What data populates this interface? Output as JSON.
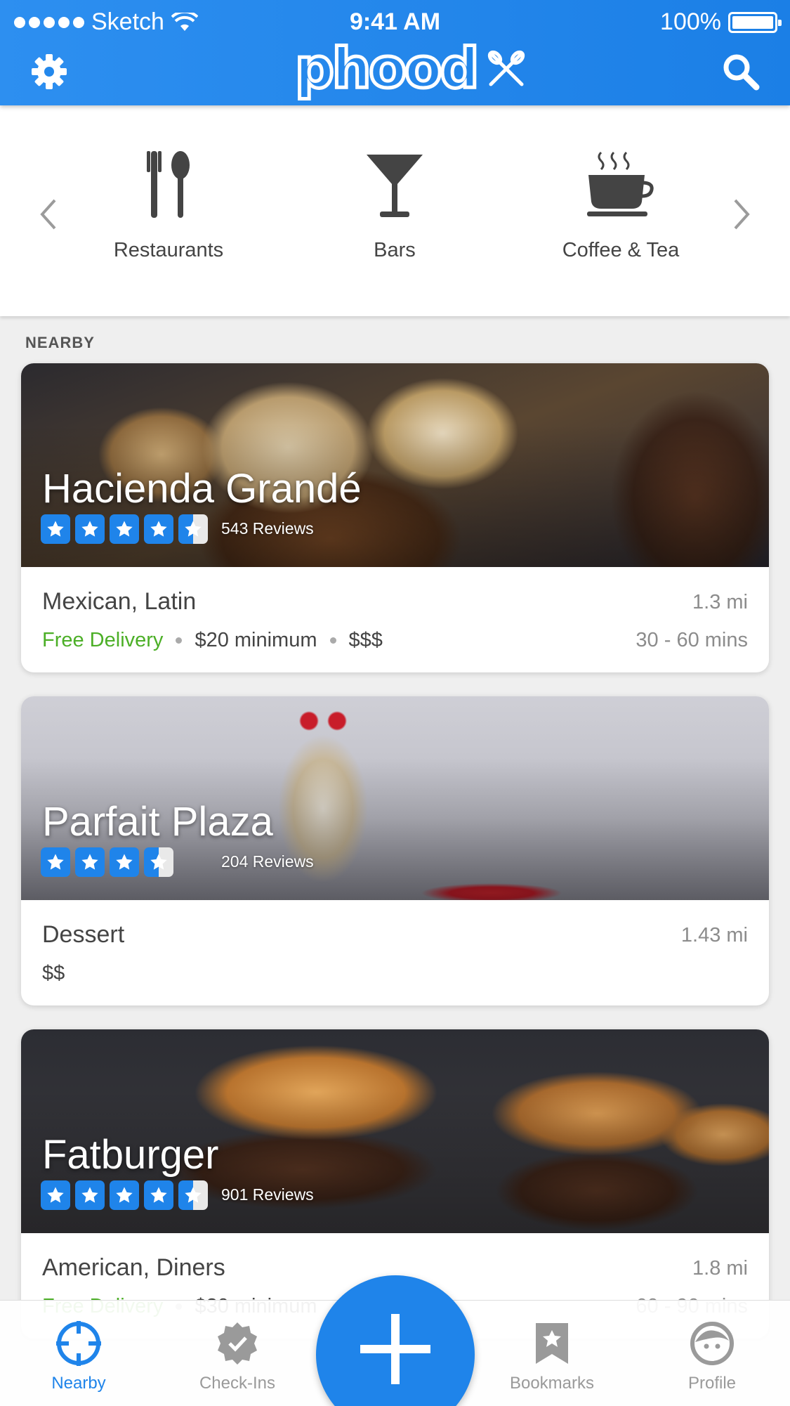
{
  "status_bar": {
    "carrier": "Sketch",
    "time": "9:41 AM",
    "battery": "100%"
  },
  "header": {
    "logo_text": "phood"
  },
  "categories": [
    {
      "label": "Restaurants",
      "icon": "fork-spoon-icon"
    },
    {
      "label": "Bars",
      "icon": "cocktail-glass-icon"
    },
    {
      "label": "Coffee & Tea",
      "icon": "coffee-cup-icon"
    }
  ],
  "section_label": "NEARBY",
  "restaurants": [
    {
      "name": "Hacienda Grandé",
      "rating": 4.5,
      "reviews": "543 Reviews",
      "cuisine": "Mexican, Latin",
      "distance": "1.3 mi",
      "delivery": "Free Delivery",
      "minimum": "$20 minimum",
      "price": "$$$",
      "eta": "30 - 60 mins"
    },
    {
      "name": "Parfait Plaza",
      "rating": 3.5,
      "reviews": "204 Reviews",
      "cuisine": "Dessert",
      "distance": "1.43 mi",
      "price": "$$"
    },
    {
      "name": "Fatburger",
      "rating": 4.5,
      "reviews": "901 Reviews",
      "cuisine": "American, Diners",
      "distance": "1.8 mi",
      "delivery": "Free Delivery",
      "minimum": "$30 minimum",
      "eta": "60 - 90 mins"
    }
  ],
  "tabs": [
    {
      "label": "Nearby",
      "icon": "crosshair-icon",
      "active": true
    },
    {
      "label": "Check-Ins",
      "icon": "checkmark-badge-icon",
      "active": false
    },
    {
      "label": "Bookmarks",
      "icon": "bookmark-star-icon",
      "active": false
    },
    {
      "label": "Profile",
      "icon": "face-icon",
      "active": false
    }
  ],
  "colors": {
    "primary": "#1f84ea",
    "delivery_green": "#4caf27",
    "muted": "#8c8c8c"
  }
}
